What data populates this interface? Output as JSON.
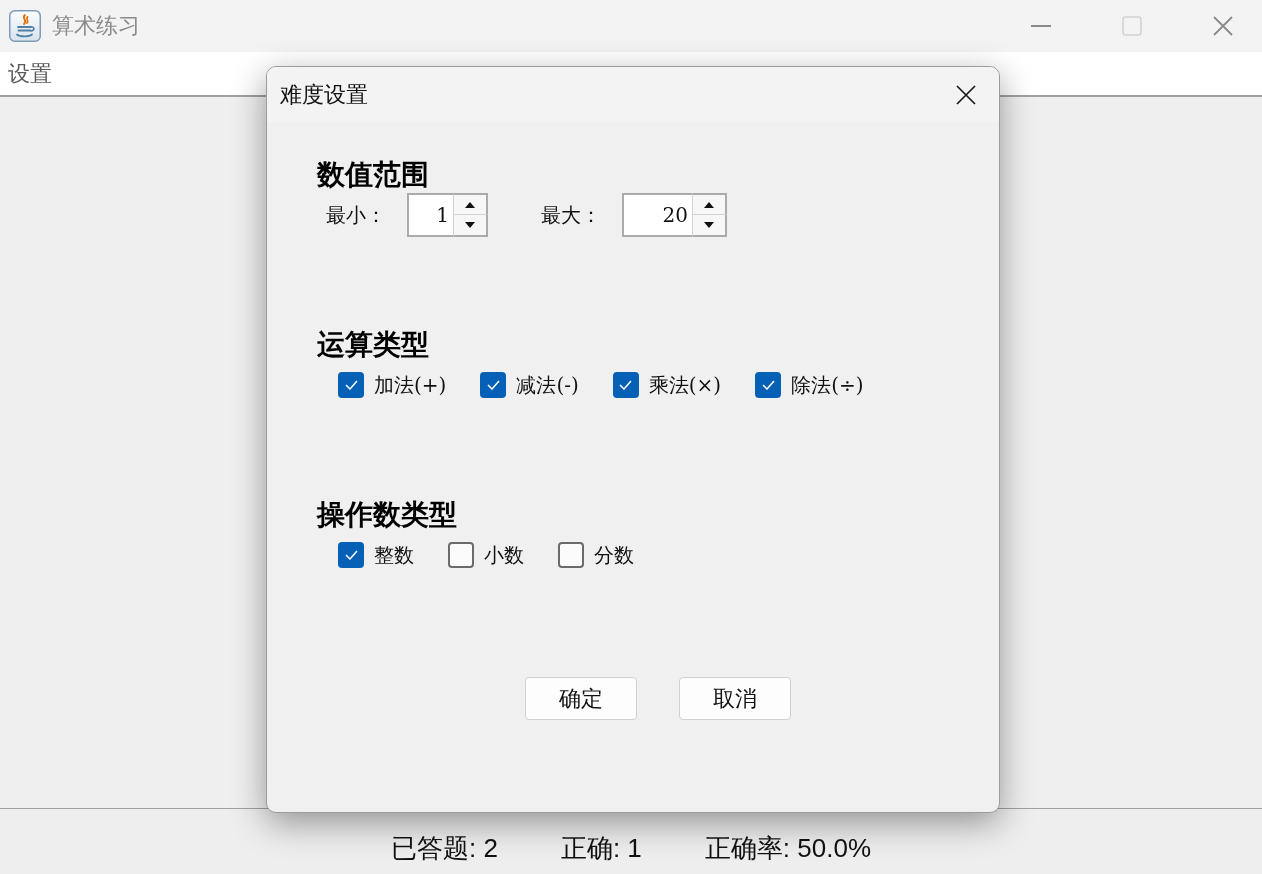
{
  "window": {
    "title": "算术练习",
    "controls": [
      {
        "kind": "minimize",
        "disabled": false
      },
      {
        "kind": "maximize",
        "disabled": true
      },
      {
        "kind": "close",
        "disabled": false
      }
    ]
  },
  "menu_bar": {
    "items": [
      "设置"
    ]
  },
  "dialog": {
    "title": "难度设置",
    "sections": [
      {
        "kind": "range",
        "heading": "数值范围",
        "fields": [
          {
            "label": "最小：",
            "value": "1"
          },
          {
            "label": "最大：",
            "value": "20"
          }
        ]
      },
      {
        "kind": "checks",
        "heading": "运算类型",
        "options": [
          {
            "label": "加法(+)",
            "checked": true
          },
          {
            "label": "减法(-)",
            "checked": true
          },
          {
            "label": "乘法(×)",
            "checked": true
          },
          {
            "label": "除法(÷)",
            "checked": true
          }
        ]
      },
      {
        "kind": "checks",
        "heading": "操作数类型",
        "options": [
          {
            "label": "整数",
            "checked": true
          },
          {
            "label": "小数",
            "checked": false
          },
          {
            "label": "分数",
            "checked": false
          }
        ]
      }
    ],
    "buttons": [
      "确定",
      "取消"
    ]
  },
  "status_bar": {
    "items": [
      "已答题: 2",
      "正确: 1",
      "正确率: 50.0%"
    ]
  }
}
